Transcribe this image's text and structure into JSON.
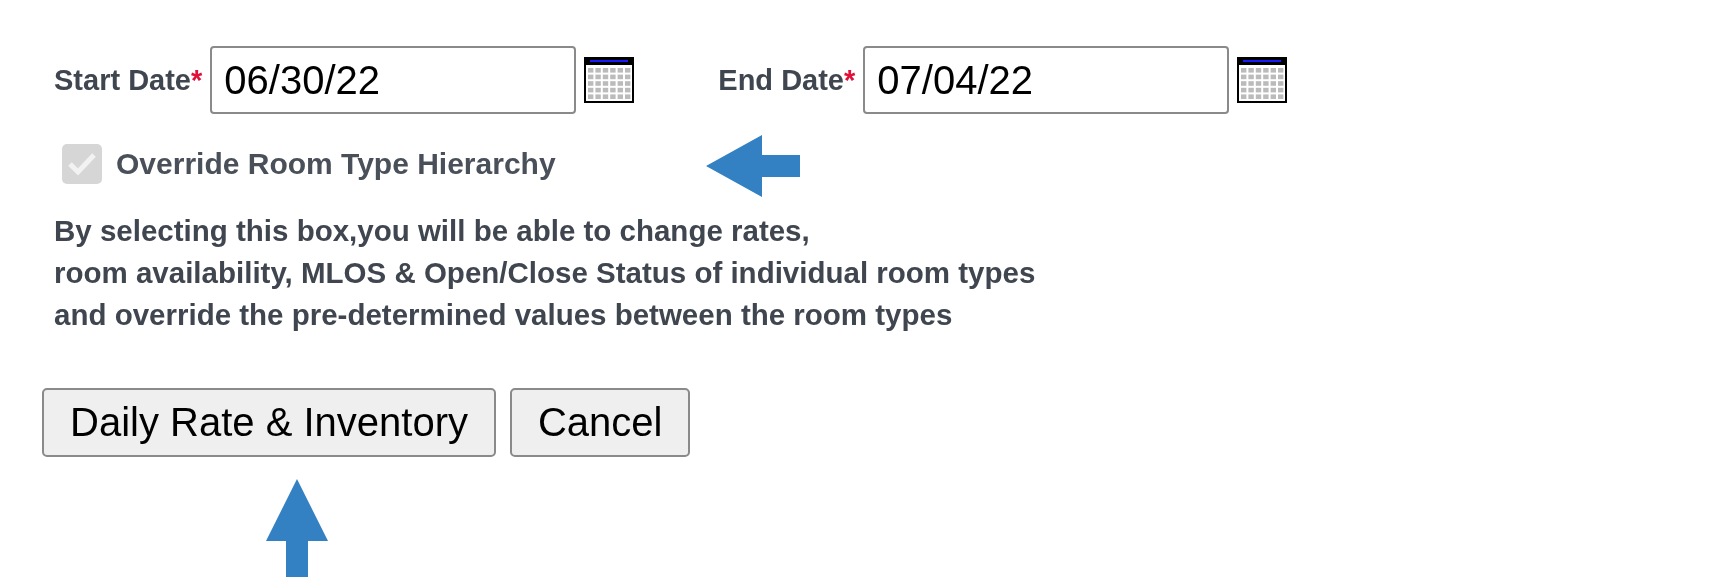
{
  "date_fields": [
    {
      "label": "Start Date",
      "required_mark": "*",
      "value": "06/30/22"
    },
    {
      "label": "End Date",
      "required_mark": "*",
      "value": "07/04/22"
    }
  ],
  "override_checkbox": {
    "label": "Override Room Type Hierarchy",
    "checked": true,
    "disabled": true
  },
  "description_lines": [
    "By selecting this box,you will be able to change rates,",
    "room availability, MLOS & Open/Close Status of individual room types",
    "and override the pre-determined values between the room types"
  ],
  "buttons": [
    "Daily Rate & Inventory",
    "Cancel"
  ]
}
